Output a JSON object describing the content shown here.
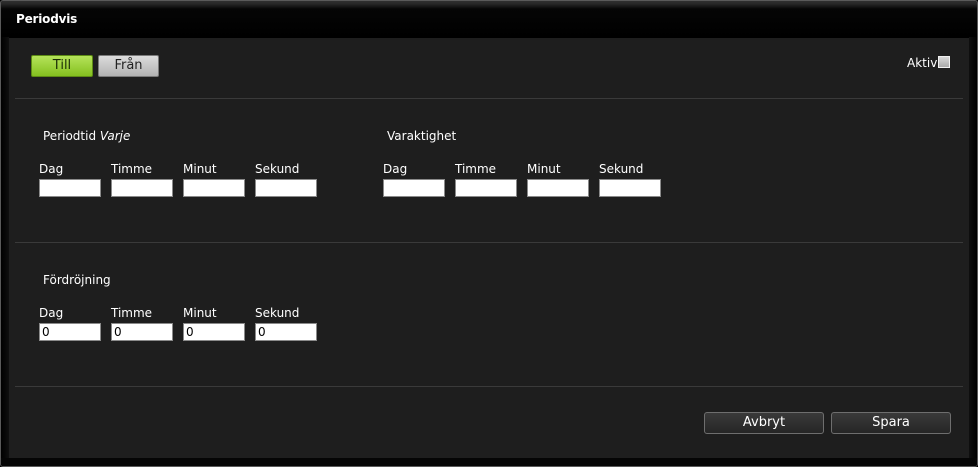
{
  "window": {
    "title": "Periodvis"
  },
  "toggle": {
    "till_label": "Till",
    "fran_label": "Från",
    "active": "Till"
  },
  "aktiv": {
    "label": "Aktiv",
    "checked": false
  },
  "periodtid": {
    "title_prefix": "Periodtid",
    "title_emphasis": "Varje",
    "labels": [
      "Dag",
      "Timme",
      "Minut",
      "Sekund"
    ],
    "values": [
      "",
      "",
      "",
      ""
    ]
  },
  "varaktighet": {
    "title": "Varaktighet",
    "labels": [
      "Dag",
      "Timme",
      "Minut",
      "Sekund"
    ],
    "values": [
      "",
      "",
      "",
      ""
    ]
  },
  "fordrojning": {
    "title": "Fördröjning",
    "labels": [
      "Dag",
      "Timme",
      "Minut",
      "Sekund"
    ],
    "values": [
      "0",
      "0",
      "0",
      "0"
    ]
  },
  "actions": {
    "cancel_label": "Avbryt",
    "save_label": "Spara"
  }
}
